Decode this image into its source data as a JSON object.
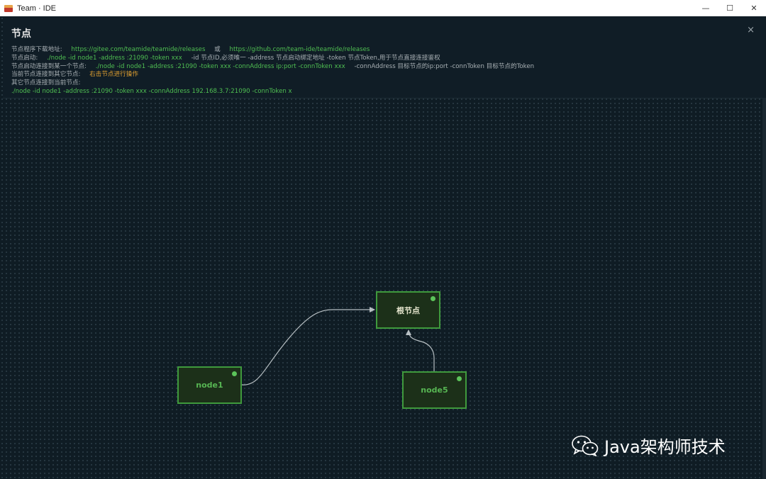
{
  "window": {
    "title": "Team · IDE",
    "minimize_icon": "minimize-icon",
    "maximize_icon": "maximize-icon",
    "close_icon": "close-icon"
  },
  "panel": {
    "title": "节点",
    "close": "×",
    "lines": {
      "download_label": "节点程序下载地址:",
      "download_gitee": "https://gitee.com/teamide/teamide/releases",
      "download_or": "或",
      "download_github": "https://github.com/team-ide/teamide/releases",
      "start_label": "节点启动:",
      "start_cmd": "./node -id node1 -address :21090 -token xxx",
      "start_desc": "-id 节点ID,必须唯一 -address 节点启动绑定地址 -token 节点Token,用于节点直接连接鉴权",
      "connect_label": "节点启动连接到某一个节点:",
      "connect_cmd": "./node -id node1 -address :21090 -token xxx -connAddress ip:port -connToken xxx",
      "connect_desc": "-connAddress 目标节点的ip:port -connToken 目标节点的Token",
      "current_label": "当前节点连接到其它节点:",
      "current_action": "右击节点进行操作",
      "other_label": "其它节点连接到当前节点:",
      "other_cmd": "./node -id node1 -address :21090 -token xxx -connAddress 192.168.3.7:21090 -connToken x"
    }
  },
  "graph": {
    "nodes": [
      {
        "id": "root",
        "label": "根节点",
        "status": "online"
      },
      {
        "id": "node1",
        "label": "node1",
        "status": "online"
      },
      {
        "id": "node5",
        "label": "node5",
        "status": "online"
      }
    ],
    "edges": [
      {
        "from": "node1",
        "to": "root"
      },
      {
        "from": "node5",
        "to": "root"
      }
    ]
  },
  "watermark": {
    "text": "Java架构师技术",
    "icon": "wechat-icon"
  },
  "colors": {
    "accent_green": "#4fbf52",
    "action_orange": "#e0a030",
    "node_border": "#3f9a3d",
    "node_fill": "#1c3019",
    "background": "#0f1c24"
  }
}
